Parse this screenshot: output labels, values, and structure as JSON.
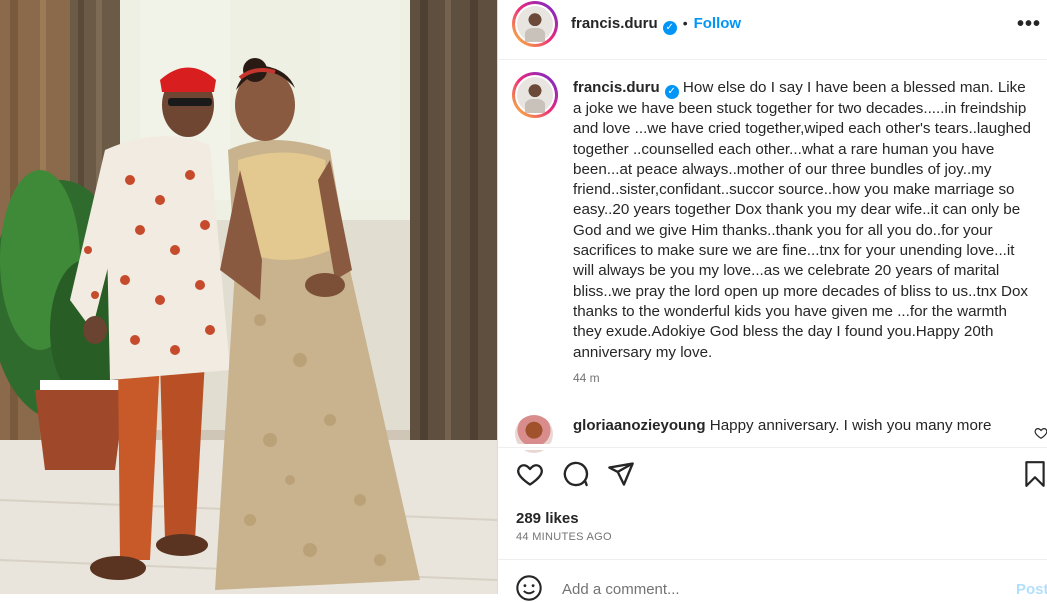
{
  "post": {
    "username": "francis.duru",
    "verified_mark": "✓",
    "separator": "•",
    "follow_label": "Follow",
    "more_label": "•••",
    "caption": "How else do I say I have been a blessed man. Like a joke we have been stuck together for two decades.....in freindship and love ...we have cried together,wiped each other's tears..laughed together ..counselled each other...what a rare human you have been...at peace always..mother of our three bundles of joy..my friend..sister,confidant..succor source..how you make marriage so easy..20 years together Dox thank you my dear wife..it can only be God and we give Him thanks..thank you for all you do..for your sacrifices to make sure we are fine...tnx for your unending love...it will always be you my love...as we celebrate 20 years of marital bliss..we pray the lord open up more decades of bliss to us..tnx Dox thanks to the wonderful kids you have given me ...for the warmth they exude.Adokiye God bless the day I found you.Happy 20th anniversary my love.",
    "time": "44 m"
  },
  "comment": {
    "username": "gloriaanozieyoung",
    "text": "Happy anniversary. I wish you many more"
  },
  "stats": {
    "likes": "289 likes",
    "ago": "44 MINUTES AGO"
  },
  "composer": {
    "placeholder": "Add a comment...",
    "post_label": "Post"
  },
  "icons": {
    "like": "heart-icon",
    "comment": "comment-icon",
    "share": "send-icon",
    "save": "bookmark-icon",
    "emoji": "emoji-icon",
    "more": "more-icon"
  },
  "colors": {
    "accent": "#0095f6",
    "muted": "#737373",
    "post_disabled": "#b2dffc"
  }
}
